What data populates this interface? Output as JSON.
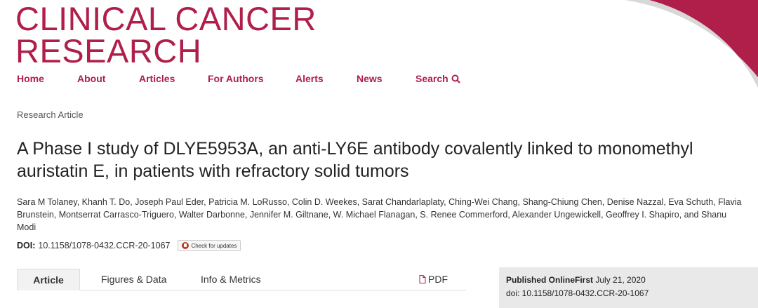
{
  "logo": {
    "line1": "CLINICAL CANCER",
    "line2": "RESEARCH"
  },
  "nav": {
    "items": [
      {
        "label": "Home"
      },
      {
        "label": "About"
      },
      {
        "label": "Articles"
      },
      {
        "label": "For Authors"
      },
      {
        "label": "Alerts"
      },
      {
        "label": "News"
      },
      {
        "label": "Search"
      }
    ]
  },
  "article": {
    "type": "Research Article",
    "title": "A Phase I study of DLYE5953A, an anti-LY6E antibody covalently linked to monomethyl auristatin E, in patients with refractory solid tumors",
    "authors": "Sara M Tolaney, Khanh T. Do, Joseph Paul Eder, Patricia M. LoRusso, Colin D. Weekes, Sarat Chandarlaplaty, Ching-Wei Chang, Shang-Chiung Chen, Denise Nazzal, Eva Schuth, Flavia Brunstein, Montserrat Carrasco-Triguero, Walter Darbonne, Jennifer M. Giltnane, W. Michael Flanagan, S. Renee Commerford, Alexander Ungewickell, Geoffrey I. Shapiro, and Shanu Modi",
    "doi_label": "DOI:",
    "doi": "10.1158/1078-0432.CCR-20-1067",
    "check_updates": "Check for updates"
  },
  "tabs": {
    "article": "Article",
    "figures": "Figures & Data",
    "info": "Info & Metrics",
    "pdf": "PDF"
  },
  "published": {
    "label": "Published OnlineFirst",
    "date": "July 21, 2020",
    "doi_line": "doi: 10.1158/1078-0432.CCR-20-1067"
  },
  "colors": {
    "brand": "#b01e4a"
  }
}
